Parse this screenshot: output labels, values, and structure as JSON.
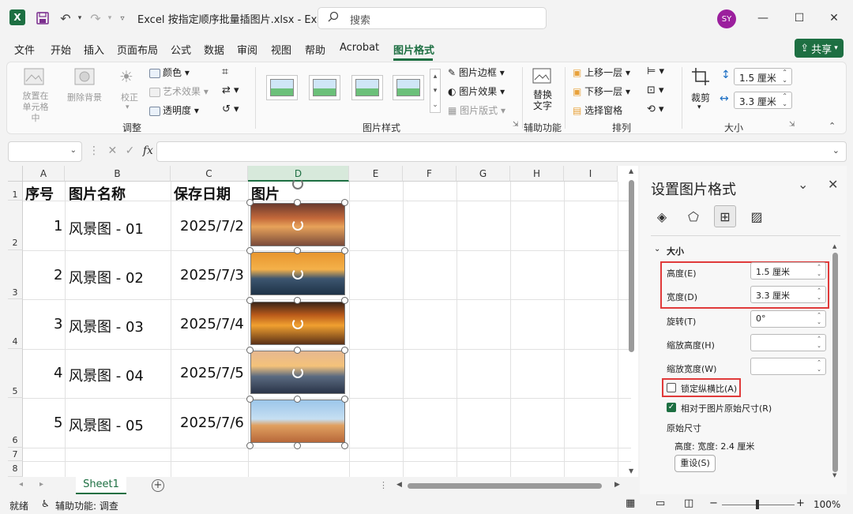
{
  "titlebar": {
    "title": "Excel 按指定顺序批量插图片.xlsx  -  Ex...",
    "search_placeholder": "搜索",
    "user_initials": "SY",
    "min": "—",
    "max": "☐",
    "close": "✕"
  },
  "menu": {
    "tabs": [
      "文件",
      "开始",
      "插入",
      "页面布局",
      "公式",
      "数据",
      "审阅",
      "视图",
      "帮助",
      "Acrobat",
      "图片格式"
    ],
    "active": "图片格式",
    "share": "共享"
  },
  "ribbon": {
    "adjust": {
      "place_in_cell": "放置在\n单元格中",
      "remove_bg": "删除背景",
      "corrections": "校正",
      "color": "颜色",
      "artistic": "艺术效果",
      "transparency": "透明度",
      "label": "调整"
    },
    "styles": {
      "border": "图片边框",
      "effects": "图片效果",
      "layout": "图片版式",
      "label": "图片样式"
    },
    "accessibility": {
      "alt_text": "替换\n文字",
      "label": "辅助功能"
    },
    "arrange": {
      "bring_forward": "上移一层",
      "send_backward": "下移一层",
      "selection_pane": "选择窗格",
      "label": "排列"
    },
    "size": {
      "crop": "裁剪",
      "height": "1.5 厘米",
      "width": "3.3 厘米",
      "label": "大小"
    }
  },
  "sheet": {
    "columns": [
      "A",
      "B",
      "C",
      "D",
      "E",
      "F",
      "G",
      "H",
      "I"
    ],
    "selected_column": "D",
    "rows": [
      "1",
      "2",
      "3",
      "4",
      "5",
      "6",
      "7",
      "8"
    ],
    "headers": [
      "序号",
      "图片名称",
      "保存日期",
      "图片"
    ],
    "data": [
      {
        "no": "1",
        "name": "风景图 - 01",
        "date": "2025/7/2"
      },
      {
        "no": "2",
        "name": "风景图 - 02",
        "date": "2025/7/3"
      },
      {
        "no": "3",
        "name": "风景图 - 03",
        "date": "2025/7/4"
      },
      {
        "no": "4",
        "name": "风景图 - 04",
        "date": "2025/7/5"
      },
      {
        "no": "5",
        "name": "风景图 - 05",
        "date": "2025/7/6"
      }
    ],
    "tab": "Sheet1"
  },
  "status": {
    "ready": "就绪",
    "accessibility": "辅助功能: 调查",
    "zoom": "100%"
  },
  "pane": {
    "title": "设置图片格式",
    "section": "大小",
    "height_label": "高度(E)",
    "height_value": "1.5 厘米",
    "width_label": "宽度(D)",
    "width_value": "3.3 厘米",
    "rotation_label": "旋转(T)",
    "rotation_value": "0°",
    "scale_h_label": "缩放高度(H)",
    "scale_w_label": "缩放宽度(W)",
    "lock_ratio_label": "锁定纵横比(A)",
    "relative_label": "相对于图片原始尺寸(R)",
    "original_size_label": "原始尺寸",
    "original_size_value": "高度:  宽度:  2.4 厘米",
    "reset": "重设(S)"
  },
  "colors": {
    "accent": "#1d6f42",
    "highlight": "#e03a3a"
  }
}
